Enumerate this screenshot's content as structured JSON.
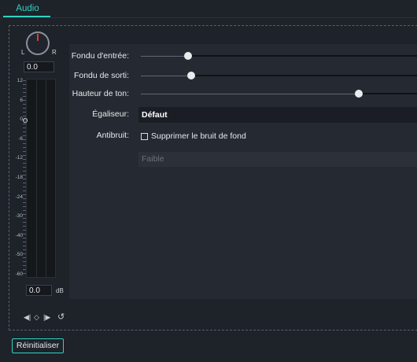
{
  "tabs": [
    {
      "label": "Audio",
      "active": true
    }
  ],
  "accent_color": "#2fd3c1",
  "pan": {
    "left_label": "L",
    "right_label": "R",
    "value": "0.0"
  },
  "meter": {
    "scale": [
      "12",
      "6",
      "0",
      "-6",
      "-12",
      "-18",
      "-24",
      "-30",
      "-40",
      "-50",
      "-60"
    ],
    "value": "0.0",
    "unit": "dB"
  },
  "keyframe_controls": {
    "prev_icon": "prev-keyframe-icon",
    "add_icon": "add-keyframe-icon",
    "next_icon": "next-keyframe-icon",
    "reset_icon": "undo-icon"
  },
  "settings": {
    "fade_in": {
      "label": "Fondu d'entrée:",
      "level": 0.11
    },
    "fade_out": {
      "label": "Fondu de sorti:",
      "level": 0.12
    },
    "pitch": {
      "label": "Hauteur de ton:",
      "level": 0.79
    },
    "equalizer": {
      "label": "Égaliseur:",
      "value": "Défaut"
    },
    "denoise": {
      "label": "Antibruit:",
      "checkbox_label": "Supprimer le bruit de fond",
      "checked": false,
      "level_value": "Faible"
    }
  },
  "reset_label": "Réinitialiser"
}
